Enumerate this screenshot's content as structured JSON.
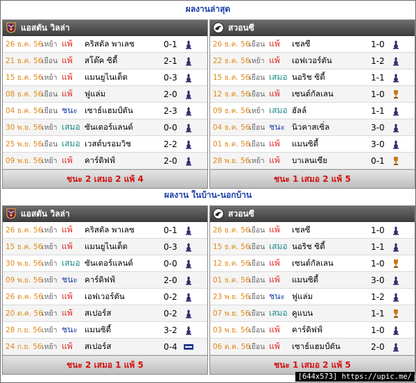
{
  "sections": [
    {
      "title": "ผลงานล่าสุด",
      "left": {
        "team": "แอสตัน วิลล่า",
        "crest_icon": "aston-villa-crest",
        "rows": [
          {
            "date": "26 ธ.ค. 56",
            "venue": "เหย้า",
            "result": "แพ้",
            "result_type": "L",
            "opponent": "คริสตัล พาเลซ",
            "score": "0-1",
            "comp_icon": "premier-league-icon"
          },
          {
            "date": "21 ธ.ค. 56",
            "venue": "เยือน",
            "result": "แพ้",
            "result_type": "L",
            "opponent": "สโต๊ค ซิตี้",
            "score": "2-1",
            "comp_icon": "premier-league-icon"
          },
          {
            "date": "15 ธ.ค. 56",
            "venue": "เหย้า",
            "result": "แพ้",
            "result_type": "L",
            "opponent": "แมนยูไนเต็ด",
            "score": "0-3",
            "comp_icon": "premier-league-icon"
          },
          {
            "date": "08 ธ.ค. 56",
            "venue": "เยือน",
            "result": "แพ้",
            "result_type": "L",
            "opponent": "ฟูแล่ม",
            "score": "2-0",
            "comp_icon": "premier-league-icon"
          },
          {
            "date": "04 ธ.ค. 56",
            "venue": "เยือน",
            "result": "ชนะ",
            "result_type": "W",
            "opponent": "เซาธ์แฮมป์ตัน",
            "score": "2-3",
            "comp_icon": "premier-league-icon"
          },
          {
            "date": "30 พ.ย. 56",
            "venue": "เหย้า",
            "result": "เสมอ",
            "result_type": "D",
            "opponent": "ซันเดอร์แลนด์",
            "score": "0-0",
            "comp_icon": "premier-league-icon"
          },
          {
            "date": "25 พ.ย. 56",
            "venue": "เยือน",
            "result": "เสมอ",
            "result_type": "D",
            "opponent": "เวสต์บรอมวิช",
            "score": "2-2",
            "comp_icon": "premier-league-icon"
          },
          {
            "date": "09 พ.ย. 56",
            "venue": "เหย้า",
            "result": "แพ้",
            "result_type": "L",
            "opponent": "คาร์ดิฟฟ์",
            "score": "2-0",
            "comp_icon": "premier-league-icon"
          }
        ],
        "summary": "ชนะ 2 เสมอ 2 แพ้ 4"
      },
      "right": {
        "team": "สวอนซี",
        "crest_icon": "swansea-crest",
        "rows": [
          {
            "date": "26 ธ.ค. 56",
            "venue": "เยือน",
            "result": "แพ้",
            "result_type": "L",
            "opponent": "เชลซี",
            "score": "1-0",
            "comp_icon": "premier-league-icon"
          },
          {
            "date": "22 ธ.ค. 56",
            "venue": "เหย้า",
            "result": "แพ้",
            "result_type": "L",
            "opponent": "เอฟเวอร์ตัน",
            "score": "1-2",
            "comp_icon": "premier-league-icon"
          },
          {
            "date": "15 ธ.ค. 56",
            "venue": "เยือน",
            "result": "เสมอ",
            "result_type": "D",
            "opponent": "นอริช ซิตี้",
            "score": "1-1",
            "comp_icon": "premier-league-icon"
          },
          {
            "date": "12 ธ.ค. 56",
            "venue": "เยือน",
            "result": "แพ้",
            "result_type": "L",
            "opponent": "เซนต์กัลเลน",
            "score": "1-0",
            "comp_icon": "europa-league-icon"
          },
          {
            "date": "09 ธ.ค. 56",
            "venue": "เหย้า",
            "result": "เสมอ",
            "result_type": "D",
            "opponent": "ฮัลล์",
            "score": "1-1",
            "comp_icon": "premier-league-icon"
          },
          {
            "date": "04 ธ.ค. 56",
            "venue": "เยือน",
            "result": "ชนะ",
            "result_type": "W",
            "opponent": "นิวคาสเซิ่ล",
            "score": "3-0",
            "comp_icon": "premier-league-icon"
          },
          {
            "date": "01 ธ.ค. 56",
            "venue": "เยือน",
            "result": "แพ้",
            "result_type": "L",
            "opponent": "แมนซิตี้",
            "score": "3-0",
            "comp_icon": "premier-league-icon"
          },
          {
            "date": "28 พ.ย. 56",
            "venue": "เหย้า",
            "result": "แพ้",
            "result_type": "L",
            "opponent": "บาเลนเซีย",
            "score": "0-1",
            "comp_icon": "europa-league-icon"
          }
        ],
        "summary": "ชนะ 1 เสมอ 2 แพ้ 5"
      }
    },
    {
      "title": "ผลงาน ในบ้าน-นอกบ้าน",
      "left": {
        "team": "แอสตัน วิลล่า",
        "crest_icon": "aston-villa-crest",
        "rows": [
          {
            "date": "26 ธ.ค. 56",
            "venue": "เหย้า",
            "result": "แพ้",
            "result_type": "L",
            "opponent": "คริสตัล พาเลซ",
            "score": "0-1",
            "comp_icon": "premier-league-icon"
          },
          {
            "date": "15 ธ.ค. 56",
            "venue": "เหย้า",
            "result": "แพ้",
            "result_type": "L",
            "opponent": "แมนยูไนเต็ด",
            "score": "0-3",
            "comp_icon": "premier-league-icon"
          },
          {
            "date": "30 พ.ย. 56",
            "venue": "เหย้า",
            "result": "เสมอ",
            "result_type": "D",
            "opponent": "ซันเดอร์แลนด์",
            "score": "0-0",
            "comp_icon": "premier-league-icon"
          },
          {
            "date": "09 พ.ย. 56",
            "venue": "เหย้า",
            "result": "ชนะ",
            "result_type": "W",
            "opponent": "คาร์ดิฟฟ์",
            "score": "2-0",
            "comp_icon": "premier-league-icon"
          },
          {
            "date": "26 ต.ค. 56",
            "venue": "เหย้า",
            "result": "แพ้",
            "result_type": "L",
            "opponent": "เอฟเวอร์ตัน",
            "score": "0-2",
            "comp_icon": "premier-league-icon"
          },
          {
            "date": "20 ต.ค. 56",
            "venue": "เหย้า",
            "result": "แพ้",
            "result_type": "L",
            "opponent": "สเปอร์ส",
            "score": "0-2",
            "comp_icon": "premier-league-icon"
          },
          {
            "date": "28 ก.ย. 56",
            "venue": "เหย้า",
            "result": "ชนะ",
            "result_type": "W",
            "opponent": "แมนซิตี้",
            "score": "3-2",
            "comp_icon": "premier-league-icon"
          },
          {
            "date": "24 ก.ย. 56",
            "venue": "เหย้า",
            "result": "แพ้",
            "result_type": "L",
            "opponent": "สเปอร์ส",
            "score": "0-4",
            "comp_icon": "league-cup-icon"
          }
        ],
        "summary": "ชนะ 2 เสมอ 1 แพ้ 5"
      },
      "right": {
        "team": "สวอนซี",
        "crest_icon": "swansea-crest",
        "rows": [
          {
            "date": "26 ธ.ค. 56",
            "venue": "เยือน",
            "result": "แพ้",
            "result_type": "L",
            "opponent": "เชลซี",
            "score": "1-0",
            "comp_icon": "premier-league-icon"
          },
          {
            "date": "15 ธ.ค. 56",
            "venue": "เยือน",
            "result": "เสมอ",
            "result_type": "D",
            "opponent": "นอริช ซิตี้",
            "score": "1-1",
            "comp_icon": "premier-league-icon"
          },
          {
            "date": "12 ธ.ค. 56",
            "venue": "เยือน",
            "result": "แพ้",
            "result_type": "L",
            "opponent": "เซนต์กัลเลน",
            "score": "1-0",
            "comp_icon": "europa-league-icon"
          },
          {
            "date": "01 ธ.ค. 56",
            "venue": "เยือน",
            "result": "แพ้",
            "result_type": "L",
            "opponent": "แมนซิตี้",
            "score": "3-0",
            "comp_icon": "premier-league-icon"
          },
          {
            "date": "23 พ.ย. 56",
            "venue": "เยือน",
            "result": "ชนะ",
            "result_type": "W",
            "opponent": "ฟูแล่ม",
            "score": "1-2",
            "comp_icon": "premier-league-icon"
          },
          {
            "date": "07 พ.ย. 56",
            "venue": "เยือน",
            "result": "เสมอ",
            "result_type": "D",
            "opponent": "คูแบน",
            "score": "1-1",
            "comp_icon": "europa-league-icon"
          },
          {
            "date": "03 พ.ย. 56",
            "venue": "เยือน",
            "result": "แพ้",
            "result_type": "L",
            "opponent": "คาร์ดิฟฟ์",
            "score": "1-0",
            "comp_icon": "premier-league-icon"
          },
          {
            "date": "06 ต.ค. 56",
            "venue": "เยือน",
            "result": "แพ้",
            "result_type": "L",
            "opponent": "เซาธ์แฮมป์ตัน",
            "score": "2-0",
            "comp_icon": "premier-league-icon"
          }
        ],
        "summary": "ชนะ 1 เสมอ 2 แพ้ 5"
      }
    }
  ],
  "footer": "[644x573] https://upic.me/"
}
